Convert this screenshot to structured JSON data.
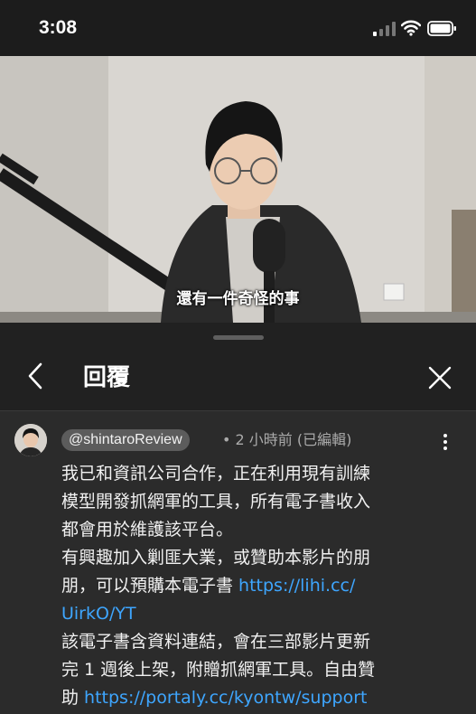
{
  "status_bar": {
    "time": "3:08"
  },
  "video": {
    "subtitle": "還有一件奇怪的事"
  },
  "panel": {
    "title": "回覆"
  },
  "comment": {
    "author": "@shintaroReview",
    "meta": "• 2 小時前 (已編輯)",
    "lines": {
      "l1": "我已和資訊公司合作，正在利用現有訓練",
      "l2": "模型開發抓網軍的工具，所有電子書收入",
      "l3": "都會用於維護該平台。",
      "l4": "有興趣加入剿匪大業，或贊助本影片的朋",
      "l5_text": "朋，可以預購本電子書 ",
      "l5_link": "https://lihi.cc/",
      "l6_link": "UirkO/YT",
      "l7": "該電子書含資料連結，會在三部影片更新",
      "l8": "完 1 週後上架，附贈抓網軍工具。自由贊",
      "l9_text": "助 ",
      "l9_link": "https://portaly.cc/kyontw/support"
    }
  },
  "icons": {
    "signal": "cellular-signal-icon",
    "wifi": "wifi-icon",
    "battery": "battery-icon",
    "back": "chevron-left-icon",
    "close": "close-icon",
    "more": "more-vertical-icon"
  },
  "colors": {
    "link": "#3ea6ff",
    "panel_bg": "#212121",
    "comment_bg": "#2b2b2b"
  }
}
